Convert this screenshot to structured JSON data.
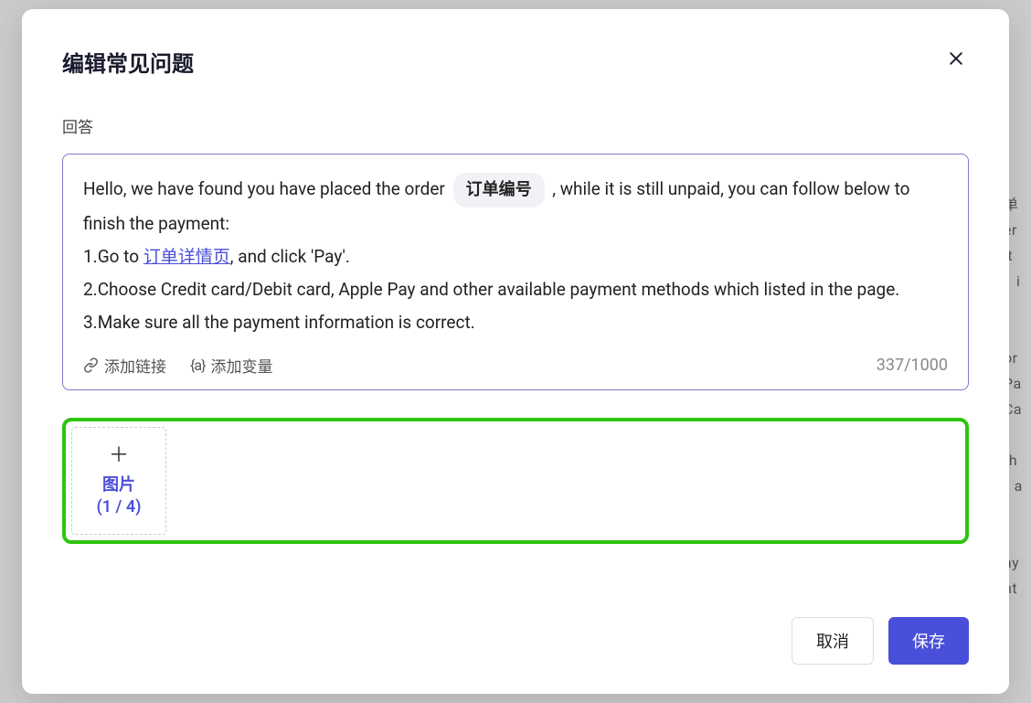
{
  "modal": {
    "title": "编辑常见问题",
    "section_label": "回答",
    "editor": {
      "text_before_chip": "Hello, we have found you have placed the order ",
      "chip_label": "订单编号",
      "text_after_chip": " , while it is still unpaid, you can follow below to finish the payment:",
      "line2_prefix": "1.Go to ",
      "line2_link": "订单详情页",
      "line2_suffix": ", and click 'Pay'.",
      "line3": "2.Choose Credit card/Debit card, Apple Pay and other available payment methods which listed in the page.",
      "line4": "3.Make sure all the payment information is correct."
    },
    "toolbar": {
      "add_link_label": "添加链接",
      "add_variable_prefix": "{a}",
      "add_variable_label": "添加变量",
      "char_count": "337/1000"
    },
    "upload": {
      "label": "图片",
      "count": "(1 / 4)"
    },
    "buttons": {
      "cancel": "取消",
      "save": "保存"
    }
  },
  "backdrop_fragments": "单\ner\nit\n1 i\n\n\nor\nPa\nCa\nr\nrh\n/ a\n\n\nay\nnt"
}
